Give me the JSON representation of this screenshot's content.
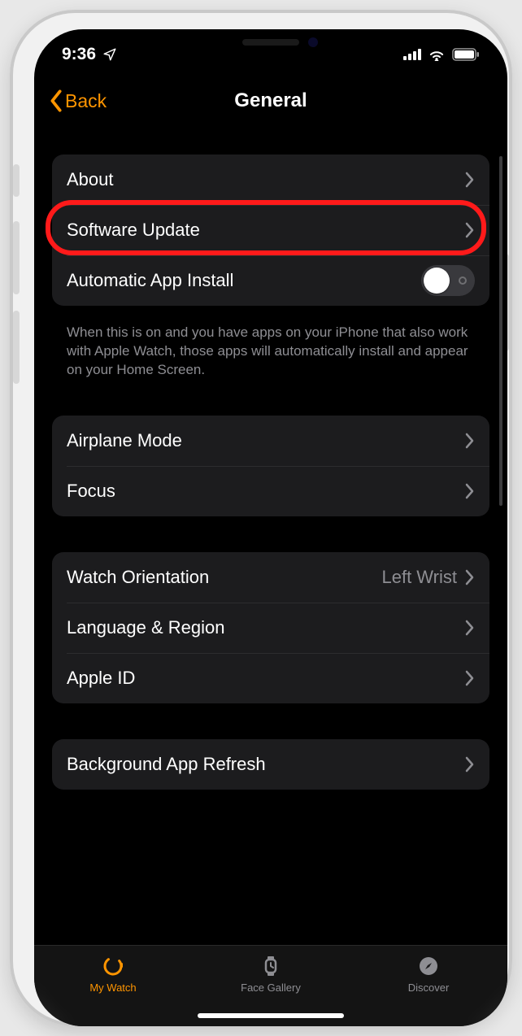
{
  "status": {
    "time": "9:36"
  },
  "nav": {
    "back_label": "Back",
    "title": "General"
  },
  "group1": {
    "about": "About",
    "software_update": "Software Update",
    "auto_install": "Automatic App Install",
    "footer": "When this is on and you have apps on your iPhone that also work with Apple Watch, those apps will automatically install and appear on your Home Screen."
  },
  "group2": {
    "airplane": "Airplane Mode",
    "focus": "Focus"
  },
  "group3": {
    "orientation_label": "Watch Orientation",
    "orientation_value": "Left Wrist",
    "lang_region": "Language & Region",
    "apple_id": "Apple ID"
  },
  "group4": {
    "background_refresh": "Background App Refresh"
  },
  "tabs": {
    "my_watch": "My Watch",
    "face_gallery": "Face Gallery",
    "discover": "Discover"
  },
  "colors": {
    "accent": "#ff9500",
    "highlight": "#ff1a1a"
  }
}
